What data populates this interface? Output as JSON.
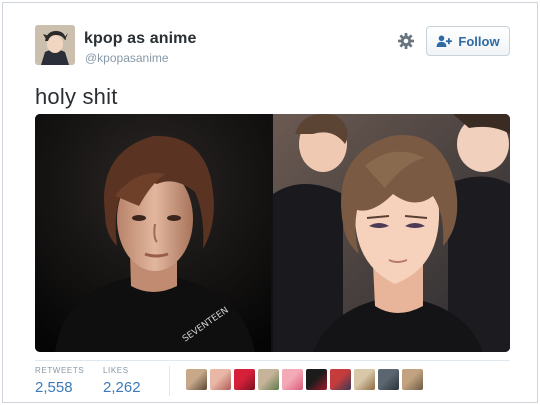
{
  "user": {
    "display_name": "kpop as anime",
    "screen_name": "@kpopasanime"
  },
  "actions": {
    "follow_label": "Follow"
  },
  "tweet": {
    "text": "holy shit"
  },
  "stats": {
    "retweets_label": "RETWEETS",
    "retweets_value": "2,558",
    "likes_label": "LIKES",
    "likes_value": "2,262"
  },
  "colors": {
    "link_blue": "#3d7ab8",
    "muted_gray": "#8899a6",
    "text_dark": "#292f33"
  },
  "likers": [
    {
      "name": "liker-1",
      "colors": [
        "#c7a98a",
        "#5a4636"
      ]
    },
    {
      "name": "liker-2",
      "colors": [
        "#e8b7a6",
        "#b25a55"
      ]
    },
    {
      "name": "liker-3",
      "colors": [
        "#d6203a",
        "#7a1020"
      ]
    },
    {
      "name": "liker-4",
      "colors": [
        "#c6b49a",
        "#5e7a4a"
      ]
    },
    {
      "name": "liker-5",
      "colors": [
        "#f3a9b6",
        "#d95b7c"
      ]
    },
    {
      "name": "liker-6",
      "colors": [
        "#1b1b1b",
        "#a01b2a"
      ]
    },
    {
      "name": "liker-7",
      "colors": [
        "#c63c3c",
        "#3a3a55"
      ]
    },
    {
      "name": "liker-8",
      "colors": [
        "#d8c7a8",
        "#8a6a42"
      ]
    },
    {
      "name": "liker-9",
      "colors": [
        "#5b6670",
        "#2d343a"
      ]
    },
    {
      "name": "liker-10",
      "colors": [
        "#c2a27f",
        "#6d5a44"
      ]
    }
  ]
}
